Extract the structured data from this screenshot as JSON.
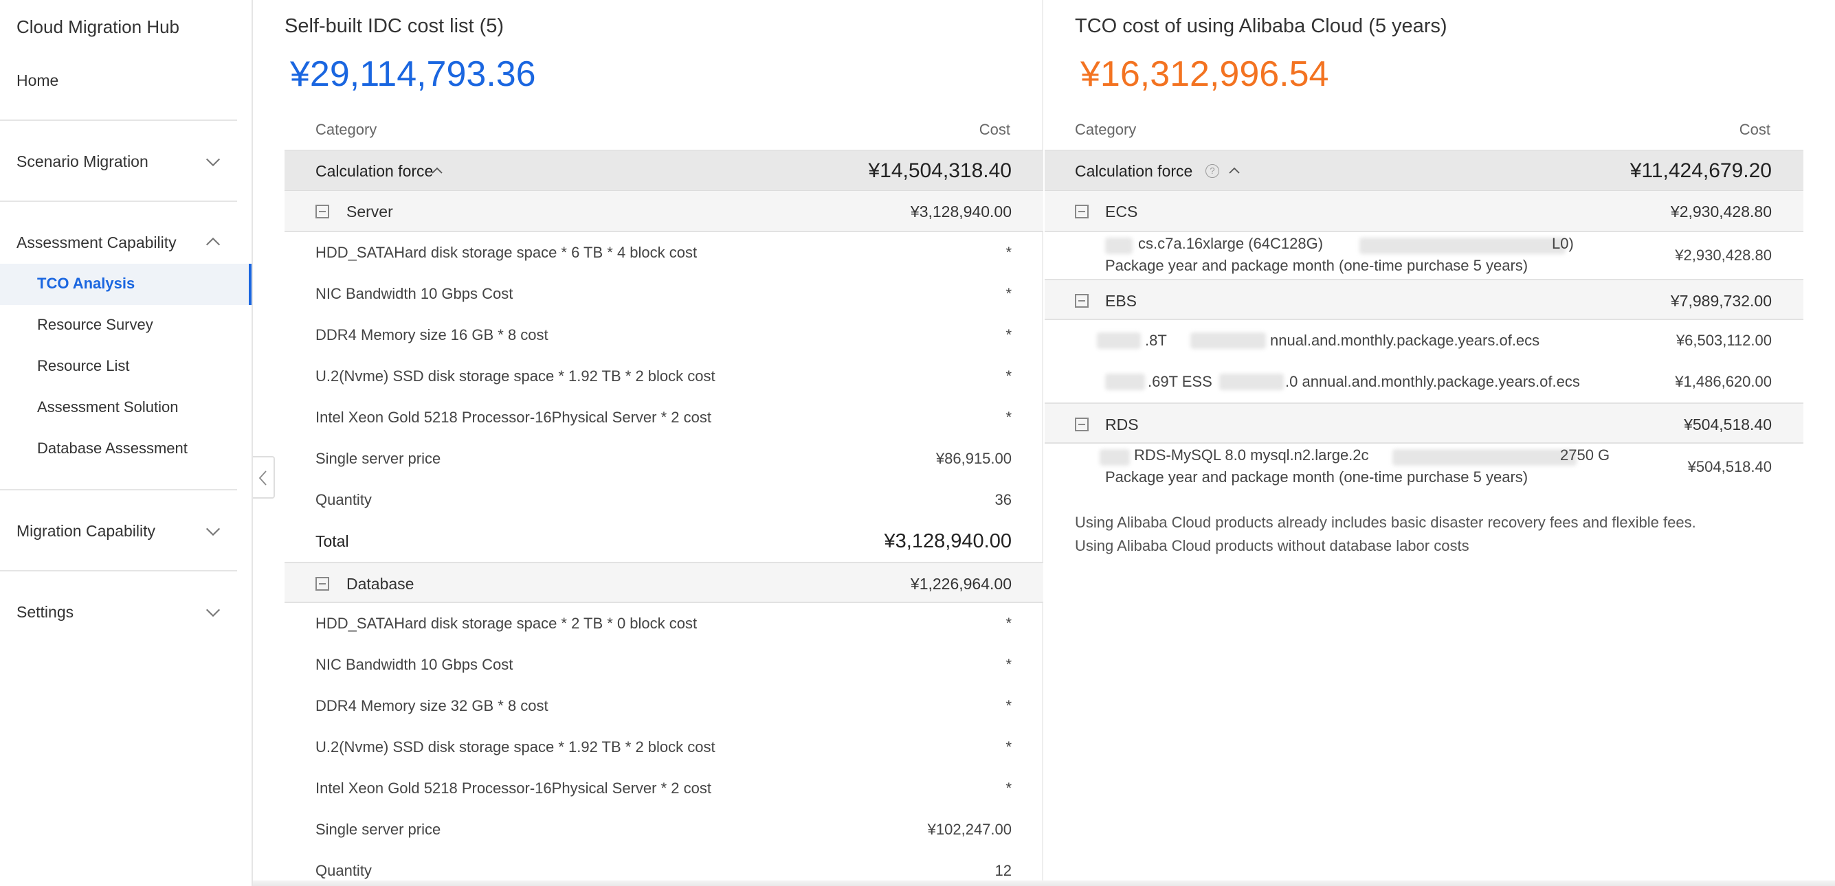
{
  "sidebar": {
    "title": "Cloud Migration Hub",
    "home": "Home",
    "groups": {
      "scenario": "Scenario Migration",
      "assessment": "Assessment Capability",
      "migration": "Migration Capability",
      "settings": "Settings"
    },
    "assessment_items": [
      "TCO Analysis",
      "Resource Survey",
      "Resource List",
      "Assessment Solution",
      "Database Assessment"
    ],
    "active_item": "TCO Analysis",
    "accent_color": "#1a66e0"
  },
  "idc": {
    "title": "Self-built IDC cost list (5)",
    "total": "¥29,114,793.36",
    "total_color": "#1a66e0",
    "col_category": "Category",
    "col_cost": "Cost",
    "calc_label": "Calculation force",
    "calc_value": "¥14,504,318.40",
    "server": {
      "label": "Server",
      "value": "¥3,128,940.00",
      "items": [
        {
          "label": "HDD_SATAHard disk storage space * 6 TB * 4 block cost",
          "value": "*"
        },
        {
          "label": "NIC Bandwidth 10 Gbps Cost",
          "value": "*"
        },
        {
          "label": "DDR4 Memory size 16 GB * 8 cost",
          "value": "*"
        },
        {
          "label": "U.2(Nvme) SSD disk storage space * 1.92 TB * 2 block cost",
          "value": "*"
        },
        {
          "label": "Intel Xeon Gold 5218 Processor-16Physical Server * 2 cost",
          "value": "*"
        },
        {
          "label": "Single server price",
          "value": "¥86,915.00"
        },
        {
          "label": "Quantity",
          "value": "36"
        }
      ],
      "total_label": "Total",
      "total_value": "¥3,128,940.00"
    },
    "database": {
      "label": "Database",
      "value": "¥1,226,964.00",
      "items": [
        {
          "label": "HDD_SATAHard disk storage space * 2 TB * 0 block cost",
          "value": "*"
        },
        {
          "label": "NIC Bandwidth 10 Gbps Cost",
          "value": "*"
        },
        {
          "label": "DDR4 Memory size 32 GB * 8 cost",
          "value": "*"
        },
        {
          "label": "U.2(Nvme) SSD disk storage space * 1.92 TB * 2 block cost",
          "value": "*"
        },
        {
          "label": "Intel Xeon Gold 5218 Processor-16Physical Server * 2 cost",
          "value": "*"
        },
        {
          "label": "Single server price",
          "value": "¥102,247.00"
        },
        {
          "label": "Quantity",
          "value": "12"
        }
      ]
    }
  },
  "cloud": {
    "title": "TCO cost of using Alibaba Cloud (5 years)",
    "total": "¥16,312,996.54",
    "total_color": "#f37321",
    "col_category": "Category",
    "col_cost": "Cost",
    "calc_label": "Calculation force",
    "calc_value": "¥11,424,679.20",
    "ecs": {
      "label": "ECS",
      "value": "¥2,930,428.80",
      "item_line1": "cs.c7a.16xlarge (64C128G)",
      "item_line1_tail": "L0)",
      "item_line2": "Package year and package month (one-time purchase 5 years)",
      "item_value": "¥2,930,428.80"
    },
    "ebs": {
      "label": "EBS",
      "value": "¥7,989,732.00",
      "item1_a": ".8T",
      "item1_b": "nnual.and.monthly.package.years.of.ecs",
      "item1_value": "¥6,503,112.00",
      "item2_a": ".69T ESS",
      "item2_b": ".0 annual.and.monthly.package.years.of.ecs",
      "item2_value": "¥1,486,620.00"
    },
    "rds": {
      "label": "RDS",
      "value": "¥504,518.40",
      "item_line1": "RDS-MySQL 8.0 mysql.n2.large.2c",
      "item_line1_tail": "2750 G",
      "item_line2": "Package year and package month (one-time purchase 5 years)",
      "item_value": "¥504,518.40"
    },
    "notes": [
      "Using Alibaba Cloud products already includes basic disaster recovery fees and flexible fees.",
      "Using Alibaba Cloud products without database labor costs"
    ]
  }
}
